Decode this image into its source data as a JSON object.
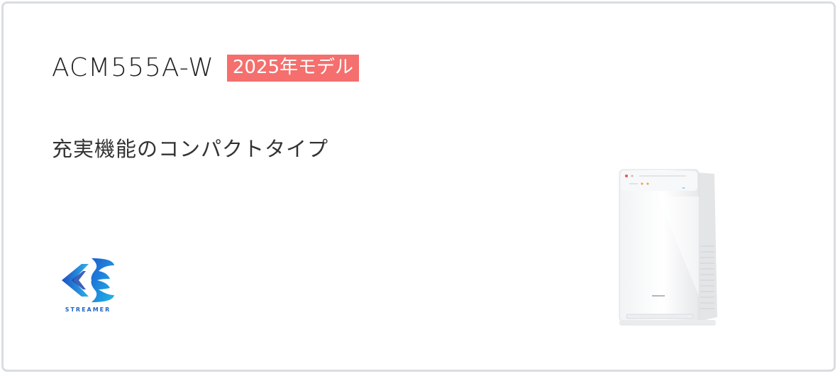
{
  "card": {
    "model": "ACM555A-W",
    "badge": "2025年モデル",
    "tagline": "充実機能のコンパクトタイプ",
    "logo": {
      "icon": "streamer-logo-icon",
      "text": "STREAMER"
    },
    "product_image": {
      "icon": "air-purifier-image"
    },
    "colors": {
      "badge": "#f46f6d",
      "logo_blue": "#1f64c8",
      "border": "#d9dde1"
    }
  }
}
